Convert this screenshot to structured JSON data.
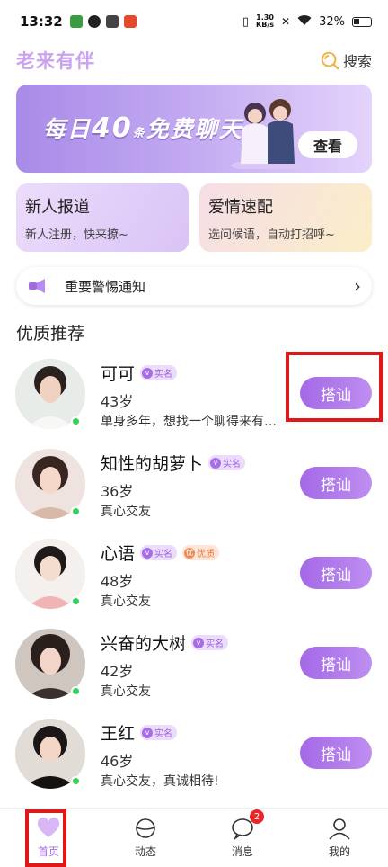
{
  "status_bar": {
    "time": "13:32",
    "net_speed_value": "1.30",
    "net_speed_unit": "KB/s",
    "battery": "32%"
  },
  "header": {
    "logo": "老来有伴",
    "search_label": "搜索"
  },
  "banner": {
    "text_prefix": "每日",
    "number": "40",
    "unit": "条",
    "text_suffix": "免费聊天",
    "button": "查看"
  },
  "cards": [
    {
      "title": "新人报道",
      "subtitle": "新人注册，快来撩~"
    },
    {
      "title": "爱情速配",
      "subtitle": "选问候语，自动打招呼~"
    }
  ],
  "notice": {
    "text": "重要警惕通知"
  },
  "section": {
    "title": "优质推荐"
  },
  "users": [
    {
      "name": "可可",
      "age": "43岁",
      "desc": "单身多年，想找一个聊得来有…",
      "badges": [
        "实名"
      ],
      "button": "搭讪"
    },
    {
      "name": "知性的胡萝卜",
      "age": "36岁",
      "desc": "真心交友",
      "badges": [
        "实名"
      ],
      "button": "搭讪"
    },
    {
      "name": "心语",
      "age": "48岁",
      "desc": "真心交友",
      "badges": [
        "实名",
        "优质"
      ],
      "button": "搭讪"
    },
    {
      "name": "兴奋的大树",
      "age": "42岁",
      "desc": "真心交友",
      "badges": [
        "实名"
      ],
      "button": "搭讪"
    },
    {
      "name": "王红",
      "age": "46岁",
      "desc": "真心交友，真诚相待!",
      "badges": [
        "实名"
      ],
      "button": "搭讪"
    }
  ],
  "tabs": [
    {
      "label": "首页",
      "icon": "heart-icon",
      "active": true
    },
    {
      "label": "动态",
      "icon": "planet-icon"
    },
    {
      "label": "消息",
      "icon": "chat-bubble-icon",
      "badge": "2"
    },
    {
      "label": "我的",
      "icon": "person-icon"
    }
  ],
  "colors": {
    "accent": "#a86de6",
    "logo": "#c9a3f0",
    "online": "#33d25a"
  }
}
